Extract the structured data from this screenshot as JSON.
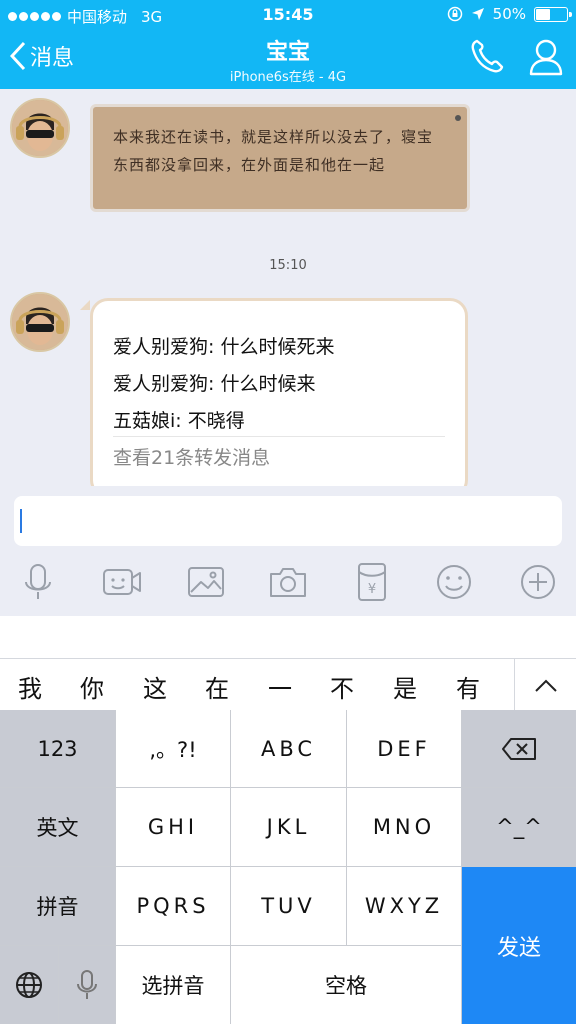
{
  "status_bar": {
    "carrier": "中国移动",
    "network": "3G",
    "time": "15:45",
    "battery": "50%",
    "battery_level": 0.5
  },
  "header": {
    "back_label": "消息",
    "title": "宝宝",
    "subtitle": "iPhone6s在线 - 4G",
    "icons": [
      "phone-icon",
      "profile-icon"
    ]
  },
  "messages": [
    {
      "type": "image-text",
      "text": "本来我还在读书，就是这样所以没去了，寝宝东西都没拿回来，在外面是和他在一起"
    },
    {
      "type": "timestamp",
      "text": "15:10"
    },
    {
      "type": "forwarded",
      "lines": [
        "爱人别爱狗: 什么时候死来",
        "爱人别爱狗: 什么时候来",
        "五菇娘i: 不晓得"
      ],
      "footer": "查看21条转发消息"
    }
  ],
  "toolbar": {
    "icons": [
      "microphone-icon",
      "video-icon",
      "image-icon",
      "camera-icon",
      "red-packet-icon",
      "emoji-icon",
      "plus-icon"
    ]
  },
  "keyboard": {
    "candidates": [
      "我",
      "你",
      "这",
      "在",
      "一",
      "不",
      "是",
      "有"
    ],
    "rows": [
      [
        "123",
        ",。?!",
        "ABC",
        "DEF",
        "delete"
      ],
      [
        "英文",
        "GHI",
        "JKL",
        "MNO",
        "^_^"
      ],
      [
        "拼音",
        "PQRS",
        "TUV",
        "WXYZ",
        "发送"
      ],
      [
        "globe",
        "mic",
        "选拼音",
        "空格"
      ]
    ],
    "labels": {
      "num": "123",
      "punct": ",。?!",
      "abc": "ABC",
      "def": "DEF",
      "english": "英文",
      "ghi": "GHI",
      "jkl": "JKL",
      "mno": "MNO",
      "emoticon": "^_^",
      "pinyin": "拼音",
      "pqrs": "PQRS",
      "tuv": "TUV",
      "wxyz": "WXYZ",
      "send": "发送",
      "select_pinyin": "选拼音",
      "space": "空格"
    }
  },
  "colors": {
    "header": "#12b7f5",
    "background": "#ebedf5",
    "send_key": "#1e88f5"
  }
}
